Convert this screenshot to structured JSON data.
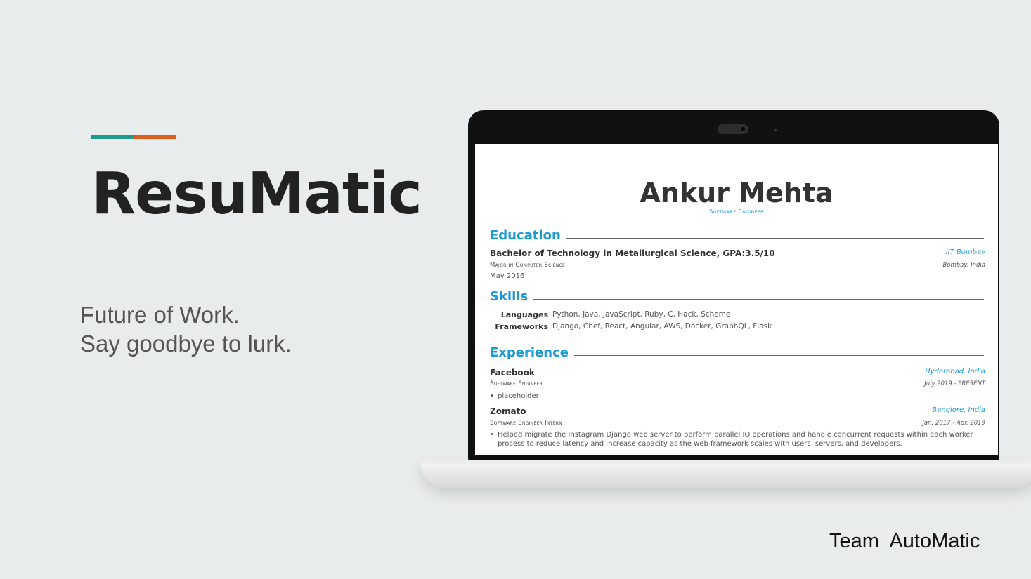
{
  "slide": {
    "title": "ResuMatic",
    "tagline": [
      "Future of Work.",
      "Say goodbye to lurk."
    ],
    "team": "Team  AutoMatic",
    "colors": {
      "background": "#e9ecec",
      "accent_teal": "#1e9a8a",
      "accent_orange": "#e15b1b"
    }
  },
  "resume": {
    "name": "Ankur Mehta",
    "role": "Software Engineer",
    "accent_color": "#1a9bd6",
    "education": {
      "heading": "Education",
      "degree": "Bachelor of Technology in Metallurgical Science, GPA:3.5/10",
      "school": "IIT Bombay",
      "major": "Major in Computer Science",
      "location": "Bombay, India",
      "date": "May 2016"
    },
    "skills": {
      "heading": "Skills",
      "items": [
        {
          "label": "Languages",
          "value": "Python, Java, JavaScript, Ruby, C, Hack, Scheme"
        },
        {
          "label": "Frameworks",
          "value": "Django, Chef, React, Angular, AWS, Docker, GraphQL, Flask"
        }
      ]
    },
    "experience": {
      "heading": "Experience",
      "jobs": [
        {
          "company": "Facebook",
          "location": "Hyderabad, India",
          "title": "Software Engineer",
          "dates": "July 2019 - PRESENT",
          "bullets": [
            "placeholder"
          ]
        },
        {
          "company": "Zomato",
          "location": "Banglore, India",
          "title": "Software Engineer Intern",
          "dates": "Jan. 2017 - Apr. 2019",
          "bullets": [
            "Helped migrate the Instagram Django web server to perform parallel IO operations and handle concurrent requests within each worker process to reduce latency and increase capacity as the web framework scales with users, servers, and developers."
          ]
        }
      ]
    }
  }
}
